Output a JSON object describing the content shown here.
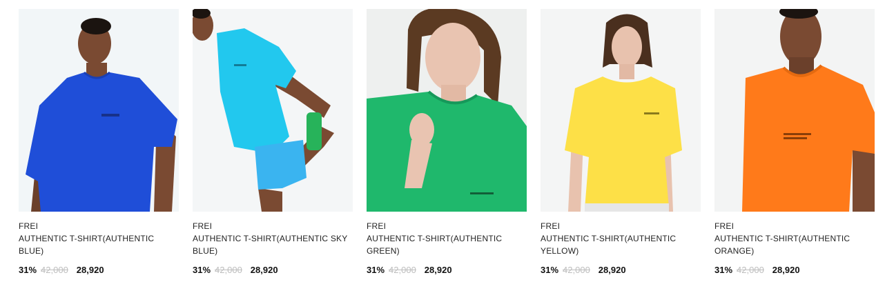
{
  "products": [
    {
      "brand": "FREI",
      "name": "AUTHENTIC T-SHIRT(AUTHENTIC BLUE)",
      "discount": "31%",
      "original_price": "42,000",
      "sale_price": "28,920",
      "shirt_color": "#1f4ed8",
      "background_color": "#f2f6f8",
      "skin_color": "#7a4a32",
      "image_subject": "man-front"
    },
    {
      "brand": "FREI",
      "name": "AUTHENTIC T-SHIRT(AUTHENTIC SKY BLUE)",
      "discount": "31%",
      "original_price": "42,000",
      "sale_price": "28,920",
      "shirt_color": "#22c8ee",
      "background_color": "#f4f6f7",
      "skin_color": "#7a4a32",
      "image_subject": "man-stretch"
    },
    {
      "brand": "FREI",
      "name": "AUTHENTIC T-SHIRT(AUTHENTIC GREEN)",
      "discount": "31%",
      "original_price": "42,000",
      "sale_price": "28,920",
      "shirt_color": "#1fb86c",
      "background_color": "#eef0ef",
      "skin_color": "#e9c4b1",
      "image_subject": "woman-closeup"
    },
    {
      "brand": "FREI",
      "name": "AUTHENTIC T-SHIRT(AUTHENTIC YELLOW)",
      "discount": "31%",
      "original_price": "42,000",
      "sale_price": "28,920",
      "shirt_color": "#fde047",
      "background_color": "#f4f5f5",
      "skin_color": "#e8c2ae",
      "image_subject": "woman-front"
    },
    {
      "brand": "FREI",
      "name": "AUTHENTIC T-SHIRT(AUTHENTIC ORANGE)",
      "discount": "31%",
      "original_price": "42,000",
      "sale_price": "28,920",
      "shirt_color": "#ff7a1a",
      "background_color": "#f3f4f4",
      "skin_color": "#7a4a32",
      "image_subject": "man-closeup"
    }
  ]
}
